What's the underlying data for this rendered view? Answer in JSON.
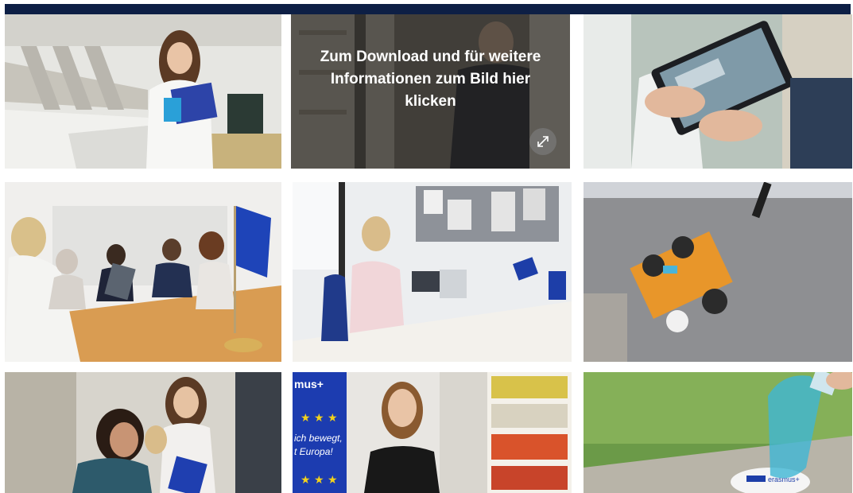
{
  "header": {
    "bar_color": "#0d1f45"
  },
  "gallery": {
    "overlay": {
      "lines": [
        "Zum Download und für weitere",
        "Informationen zum Bild hier",
        "klicken"
      ],
      "expand_icon": "expand-arrows-icon"
    },
    "tiles": [
      {
        "id": "tile-1",
        "subject": "student-with-eu-folder-stairs"
      },
      {
        "id": "tile-2",
        "subject": "man-in-library-hovered"
      },
      {
        "id": "tile-3",
        "subject": "hands-holding-tablet"
      },
      {
        "id": "tile-4",
        "subject": "meeting-with-eu-flag"
      },
      {
        "id": "tile-5",
        "subject": "woman-at-desk-office"
      },
      {
        "id": "tile-6",
        "subject": "aerial-people-at-table"
      },
      {
        "id": "tile-7",
        "subject": "three-students-smiling"
      },
      {
        "id": "tile-8",
        "subject": "young-woman-erasmus-poster"
      },
      {
        "id": "tile-9",
        "subject": "water-bottle-erasmus-coaster"
      }
    ],
    "poster_text": [
      "mus+",
      "ich bewegt,",
      "t Europa!"
    ],
    "coaster_text": "erasmus+"
  }
}
